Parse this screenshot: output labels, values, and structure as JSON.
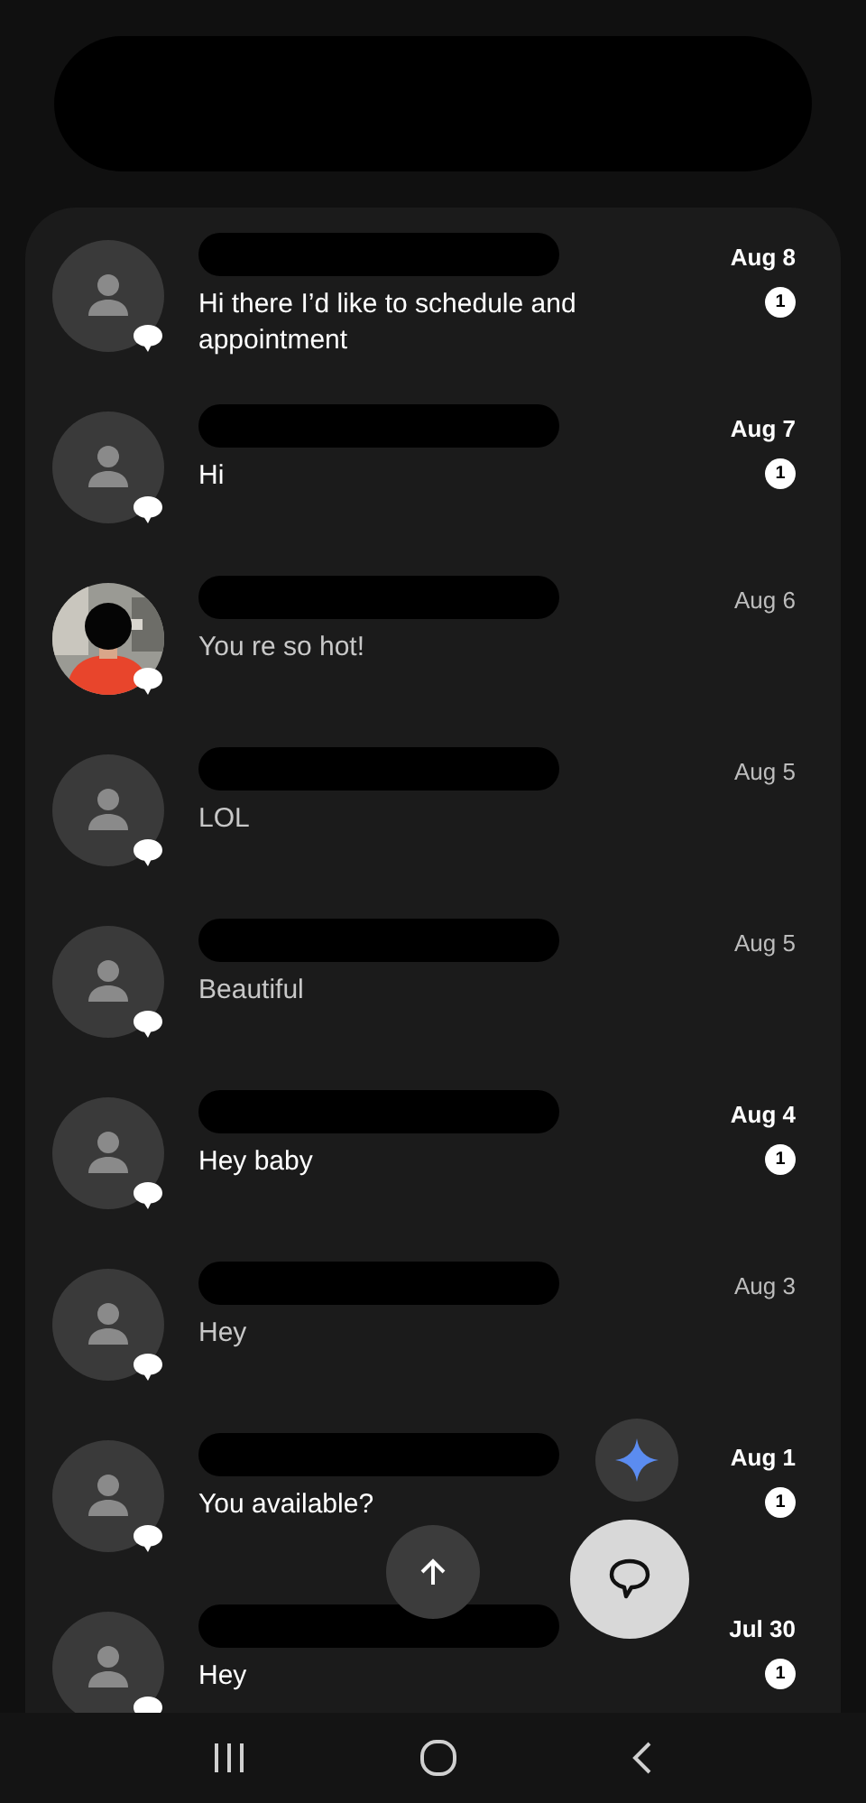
{
  "conversations": [
    {
      "kind": "contact",
      "date": "Aug 8",
      "unread": true,
      "badge": "1",
      "message": "Hi there I’d like to schedule and appointment"
    },
    {
      "kind": "contact",
      "date": "Aug 7",
      "unread": true,
      "badge": "1",
      "message": "Hi"
    },
    {
      "date": "Aug 6",
      "unread": false,
      "message": "You re so hot!"
    },
    {
      "kind": "contact",
      "date": "Aug 5",
      "unread": false,
      "message": "LOL"
    },
    {
      "kind": "contact",
      "date": "Aug 5",
      "unread": false,
      "message": "Beautiful"
    },
    {
      "kind": "contact",
      "date": "Aug 4",
      "unread": true,
      "badge": "1",
      "message": "Hey baby"
    },
    {
      "kind": "contact",
      "date": "Aug 3",
      "unread": false,
      "message": "Hey"
    },
    {
      "kind": "contact",
      "date": "Aug 1",
      "unread": true,
      "badge": "1",
      "message": "You available?"
    },
    {
      "kind": "contact",
      "date": "Jul 30",
      "unread": true,
      "badge": "1",
      "message": "Hey"
    }
  ]
}
